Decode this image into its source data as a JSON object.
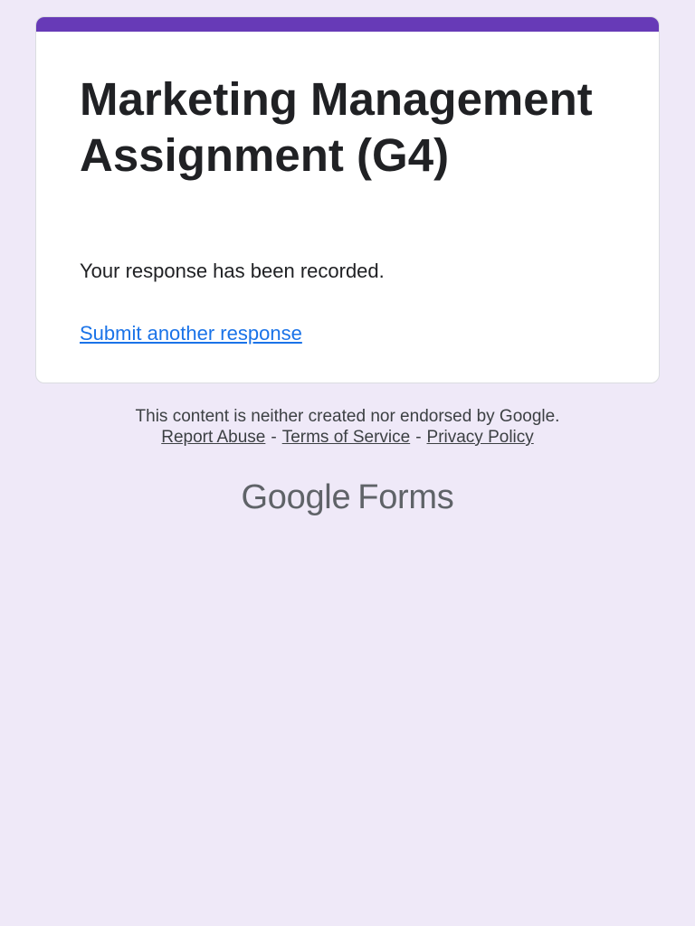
{
  "form": {
    "title": "Marketing Management Assignment (G4)",
    "confirmation": "Your response has been recorded.",
    "submit_another_label": "Submit another response",
    "accent_color": "#673ab7",
    "link_color": "#1a73e8"
  },
  "footer": {
    "disclaimer": "This content is neither created nor endorsed by Google.",
    "links": {
      "report_abuse": "Report Abuse",
      "terms": "Terms of Service",
      "privacy": "Privacy Policy"
    },
    "separator": "-"
  },
  "brand": {
    "google": "Google",
    "product": "Forms"
  },
  "theme": {
    "page_background": "#efe9f8",
    "card_background": "#ffffff"
  }
}
